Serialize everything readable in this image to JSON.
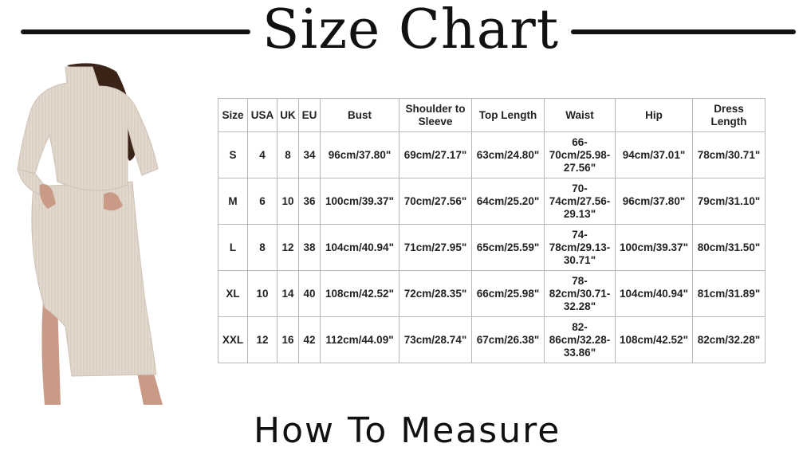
{
  "header": {
    "title": "Size Chart"
  },
  "table": {
    "columns": [
      "Size",
      "USA",
      "UK",
      "EU",
      "Bust",
      "Shoulder to Sleeve",
      "Top Length",
      "Waist",
      "Hip",
      "Dress Length"
    ],
    "rows": [
      [
        "S",
        "4",
        "8",
        "34",
        "96cm/37.80\"",
        "69cm/27.17\"",
        "63cm/24.80\"",
        "66-70cm/25.98-27.56\"",
        "94cm/37.01\"",
        "78cm/30.71\""
      ],
      [
        "M",
        "6",
        "10",
        "36",
        "100cm/39.37\"",
        "70cm/27.56\"",
        "64cm/25.20\"",
        "70-74cm/27.56-29.13\"",
        "96cm/37.80\"",
        "79cm/31.10\""
      ],
      [
        "L",
        "8",
        "12",
        "38",
        "104cm/40.94\"",
        "71cm/27.95\"",
        "65cm/25.59\"",
        "74-78cm/29.13-30.71\"",
        "100cm/39.37\"",
        "80cm/31.50\""
      ],
      [
        "XL",
        "10",
        "14",
        "40",
        "108cm/42.52\"",
        "72cm/28.35\"",
        "66cm/25.98\"",
        "78-82cm/30.71-32.28\"",
        "104cm/40.94\"",
        "81cm/31.89\""
      ],
      [
        "XXL",
        "12",
        "16",
        "42",
        "112cm/44.09\"",
        "73cm/28.74\"",
        "67cm/26.38\"",
        "82-86cm/32.28-33.86\"",
        "108cm/42.52\"",
        "82cm/32.28\""
      ]
    ]
  },
  "footer": {
    "text": "How To Measure"
  },
  "colors": {
    "garment": "#e3d8cd",
    "hair": "#3a2418",
    "skin": "#c99a86",
    "border": "#b8b8b8"
  }
}
